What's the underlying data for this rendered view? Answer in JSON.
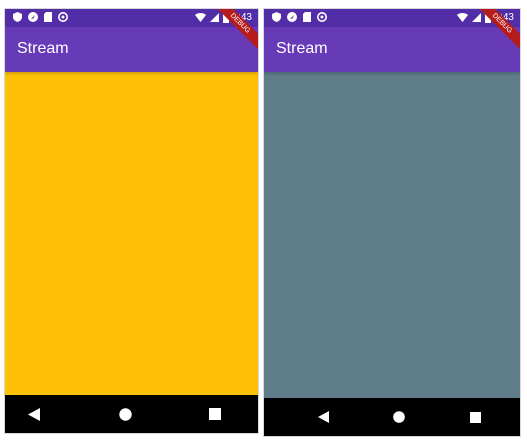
{
  "screens": [
    {
      "statusbar": {
        "time": "2:43",
        "left_icons": [
          "shield-icon",
          "location-icon",
          "sd-card-icon",
          "sync-icon"
        ],
        "right_icons": [
          "wifi-icon",
          "signal-icon",
          "battery-icon"
        ],
        "color": "#512da8"
      },
      "appbar": {
        "title": "Stream",
        "color": "#673ab7"
      },
      "debug_banner": "DEBUG",
      "body": {
        "color": "#ffc107"
      },
      "navbar": {
        "buttons": [
          "back-icon",
          "home-icon",
          "recents-icon"
        ],
        "color": "#000000"
      }
    },
    {
      "statusbar": {
        "time": "2:43",
        "left_icons": [
          "shield-icon",
          "location-icon",
          "sd-card-icon",
          "sync-icon"
        ],
        "right_icons": [
          "wifi-icon",
          "signal-icon",
          "battery-icon"
        ],
        "color": "#512da8"
      },
      "appbar": {
        "title": "Stream",
        "color": "#673ab7"
      },
      "debug_banner": "DEBUG",
      "body": {
        "color": "#607d8b"
      },
      "navbar": {
        "buttons": [
          "back-icon",
          "home-icon",
          "recents-icon"
        ],
        "color": "#000000"
      }
    }
  ]
}
